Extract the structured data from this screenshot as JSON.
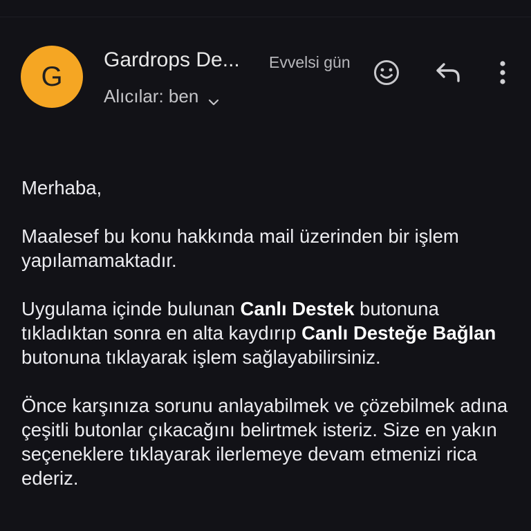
{
  "email": {
    "sender_initial": "G",
    "sender_name": "Gardrops De...",
    "date": "Evvelsi gün",
    "recipients": "Alıcılar: ben"
  },
  "icons": {
    "emoji": "emoji-reaction-icon",
    "reply": "reply-icon",
    "more": "more-vertical-icon",
    "expand": "chevron-down-icon"
  },
  "colors": {
    "background": "#121217",
    "avatar": "#f5a623",
    "text": "#ececf0"
  },
  "body": {
    "greeting": "Merhaba,",
    "p1": "Maalesef bu konu hakkında mail üzerinden bir işlem yapılamamaktadır.",
    "p2_a": "Uygulama içinde bulunan ",
    "p2_bold1": "Canlı Destek",
    "p2_b": " butonuna tıkladıktan sonra en alta kaydırıp ",
    "p2_bold2": "Canlı Desteğe Bağlan",
    "p2_c": " butonuna tıklayarak işlem sağlayabilirsiniz.",
    "p3": "Önce karşınıza sorunu anlayabilmek ve çözebilmek adına çeşitli butonlar çıkacağını belirtmek isteriz. Size en yakın seçeneklere tıklayarak ilerlemeye devam etmenizi rica ederiz."
  }
}
